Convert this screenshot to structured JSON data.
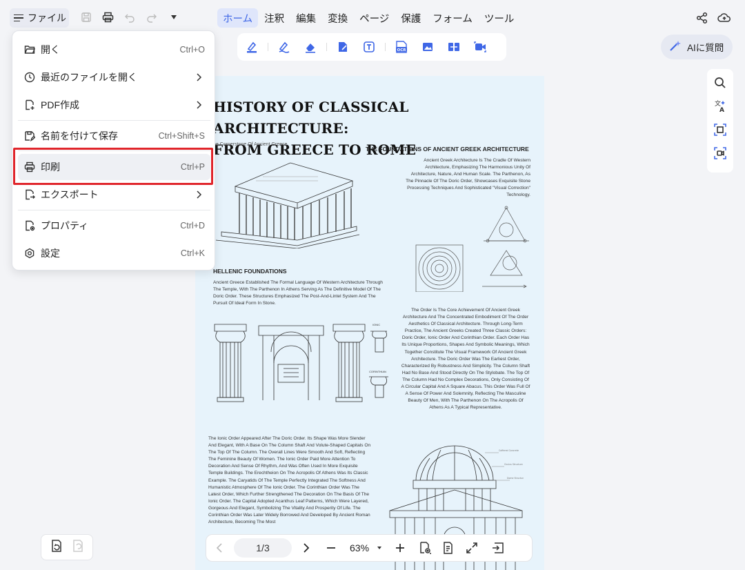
{
  "topbar": {
    "file_label": "ファイル",
    "tabs": [
      "ホーム",
      "注釈",
      "編集",
      "変換",
      "ページ",
      "保護",
      "フォーム",
      "ツール"
    ],
    "active_tab": "ホーム",
    "ai_label": "AIに質問"
  },
  "file_menu": {
    "items": [
      {
        "label": "開く",
        "shortcut": "Ctrl+O",
        "icon": "folder-open-icon"
      },
      {
        "label": "最近のファイルを開く",
        "shortcut": "",
        "icon": "clock-icon"
      },
      {
        "label": "PDF作成",
        "shortcut": "",
        "icon": "file-plus-icon"
      },
      {
        "label": "名前を付けて保存",
        "shortcut": "Ctrl+Shift+S",
        "icon": "save-as-icon"
      },
      {
        "label": "印刷",
        "shortcut": "Ctrl+P",
        "icon": "printer-icon"
      },
      {
        "label": "エクスポート",
        "shortcut": "",
        "icon": "export-icon"
      },
      {
        "label": "プロパティ",
        "shortcut": "Ctrl+D",
        "icon": "properties-icon"
      },
      {
        "label": "設定",
        "shortcut": "Ctrl+K",
        "icon": "settings-icon"
      }
    ],
    "highlighted": "印刷"
  },
  "document": {
    "title_line1": "HISTORY OF CLASSICAL  ARCHITECTURE:",
    "title_line2": "FROM GREECE TO ROME",
    "subtitle": "he Cornerstone Of Ancient Greece",
    "h_foundations": "THE FOUNDATIONS OF ANCIENT GREEK ARCHITECTURE",
    "p_foundations": "Ancient Greek Architecture Is The Cradle Of Western Architecture, Emphasizing The Harmonious Unity Of Architecture, Nature, And Human Scale. The Parthenon, As The Pinnacle Of The Doric Order, Showcases Exquisite Stone Processing Techniques And Sophisticated \"Visual Correction\" Technology.",
    "h_hellenic": "HELLENIC FOUNDATIONS",
    "p_hellenic": "Ancient Greece Established The Formal Language Of Western Architecture Through The Temple, With The Parthenon In Athens Serving As The Definitive Model Of The Doric Order. These Structures Emphasized The Post-And-Lintel System And The Pursuit Of Ideal Form In Stone.",
    "p_order": "The Order Is The Core Achievement Of Ancient Greek Architecture And The Concentrated Embodiment Of The Order Aesthetics Of Classical Architecture. Through Long-Term Practice, The Ancient Greeks Created Three Classic Orders: Doric Order, Ionic Order And Corinthian Order. Each Order Has Its Unique Proportions, Shapes And Symbolic Meanings, Which Together Constitute The Visual Framework Of Ancient Greek Architecture. The Doric Order Was The Earliest Order, Characterized By Robustness And Simplicity. The Column Shaft Had No Base And Stood Directly On The Stylobate. The Top Of The Column Had No Complex Decorations, Only Consisting Of A Circular Capital And A Square Abacus. This Order Was Full Of A Sense Of Power And Solemnity, Reflecting The Masculine Beauty Of Men, With The Parthenon On The Acropolis Of Athens As A Typical Representative.",
    "p_ionic": "The Ionic Order Appeared After The Doric Order. Its Shape Was More Slender And Elegant, With A Base On The Column Shaft And Volute-Shaped Capitals On The Top Of The Column. The Overall Lines Were Smooth And Soft, Reflecting The Feminine Beauty Of Women. The Ionic Order Paid More Attention To Decoration And Sense Of Rhythm, And Was Often Used In More Exquisite Temple Buildings. The Erechtheion On The Acropolis Of Athens Was Its Classic Example. The Caryatids Of The Temple Perfectly Integrated The Softness And Humanistic Atmosphere Of The Ionic Order. The Corinthian Order Was The Latest Order, Which Further Strengthened The Decoration On The Basis Of The Ionic Order. The Capital Adopted Acanthus Leaf Patterns, Which Were Layered, Gorgeous And Elegant, Symbolizing The Vitality And Prosperity Of Life. The Corinthian Order Was Later Widely Borrowed And Developed By Ancient Roman Architecture, Becoming The Most",
    "small_ionic": "IONIC",
    "small_corinthian": "CORINTHIAN"
  },
  "navigation": {
    "page_indicator": "1/3",
    "zoom": "63%"
  },
  "colors": {
    "accent": "#3f67e6",
    "highlight_box": "#e0252b",
    "page_background": "#e7f3fb"
  }
}
